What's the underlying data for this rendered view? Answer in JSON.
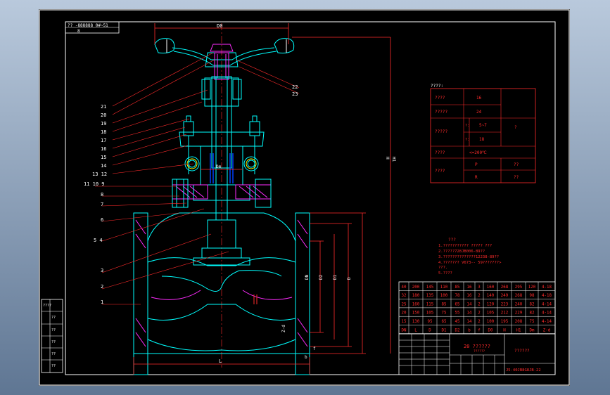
{
  "stamp": {
    "line1": "?? -888888 0#~51",
    "line2": "8"
  },
  "dims": {
    "top": "D0",
    "height": "H",
    "height_alt": "H1",
    "dm": "Dm",
    "d": "DN",
    "d1": "D1",
    "d2": "D2",
    "d_outer": "D",
    "length": "L",
    "flange": "f",
    "bolt": "Z-d",
    "b": "b"
  },
  "callouts": [
    "21",
    "20",
    "19",
    "18",
    "17",
    "16",
    "15",
    "14",
    "13 12",
    "11 10  9",
    "8",
    "7",
    "6",
    "5  4",
    "3",
    "2",
    "1",
    "22",
    "23"
  ],
  "spec_table": {
    "title": "????:",
    "rows": [
      {
        "label": "????",
        "value": "16"
      },
      {
        "label": "?????",
        "value": "24"
      },
      {
        "label": "?????",
        "sub1": "?:",
        "val1": "5~7",
        "sub2": "?:",
        "val2": "18",
        "side": "?"
      },
      {
        "label": "????",
        "value": "<=200℃"
      },
      {
        "label": "????",
        "sub1": "P",
        "val1": "??",
        "sub2": "R",
        "val2": "??"
      }
    ]
  },
  "notes": {
    "title": "???",
    "lines": [
      "1.???????????  ?????  ???",
      "2.?????728JB006-89??",
      "3.??????????????12238-89??",
      "4.??????? V673-- 59???????>",
      "   ???.",
      "5.????"
    ]
  },
  "dim_table": {
    "rows": [
      [
        "40",
        "200",
        "145",
        "110",
        "85",
        "16",
        "3",
        "160",
        "268",
        "295",
        "120",
        "4-18"
      ],
      [
        "32",
        "180",
        "135",
        "100",
        "78",
        "16",
        "2",
        "140",
        "249",
        "268",
        "98",
        "4-18"
      ],
      [
        "25",
        "160",
        "115",
        "85",
        "65",
        "14",
        "2",
        "120",
        "223",
        "240",
        "82",
        "4-14"
      ],
      [
        "20",
        "150",
        "105",
        "75",
        "55",
        "14",
        "2",
        "105",
        "212",
        "229",
        "82",
        "4-14"
      ],
      [
        "15",
        "130",
        "95",
        "65",
        "45",
        "14",
        "2",
        "100",
        "195",
        "208",
        "75",
        "4-14"
      ]
    ],
    "header": [
      "DN",
      "L",
      "D",
      "D1",
      "D2",
      "b",
      "f",
      "D0",
      "H",
      "H1",
      "Dm",
      "Z-d"
    ]
  },
  "title_block": {
    "material": "20 ??????",
    "material_sub": "??????",
    "name": "??????",
    "code": "J5-40JB8G8JB-22"
  },
  "left_strip": [
    "????",
    "??",
    "??",
    "??",
    "??",
    "??"
  ]
}
